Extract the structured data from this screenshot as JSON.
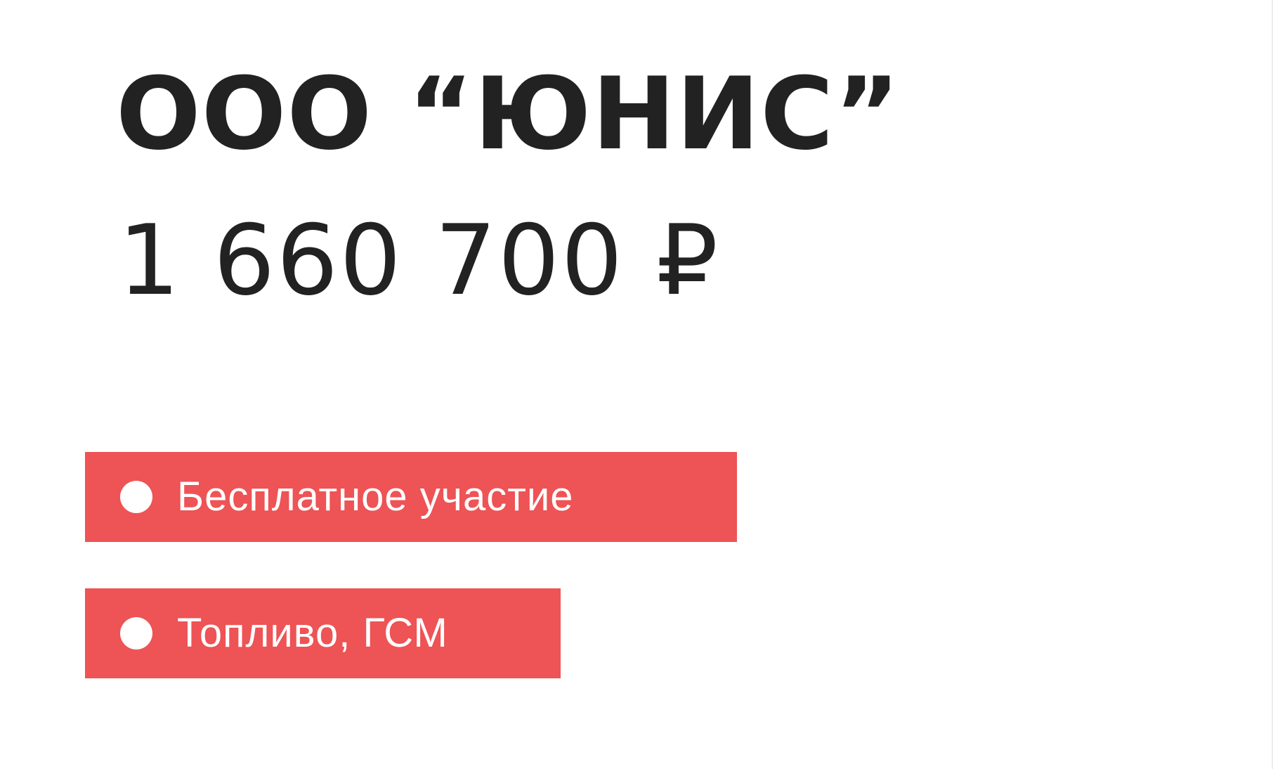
{
  "company": {
    "name": "ООО “ЮНИС”",
    "amount": "1 660 700 ₽"
  },
  "tags": [
    {
      "label": "Бесплатное участие",
      "icon": "dot-icon",
      "color": "#ee5355"
    },
    {
      "label": "Топливо, ГСМ",
      "icon": "dot-icon",
      "color": "#ee5355"
    }
  ]
}
